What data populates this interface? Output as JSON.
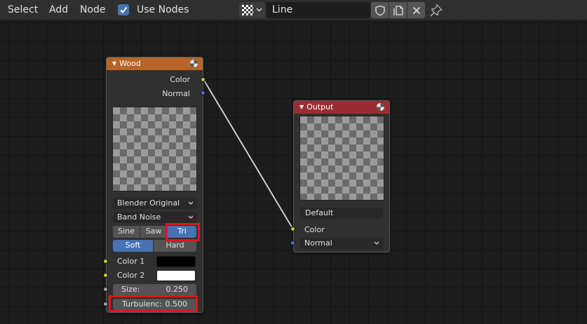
{
  "header": {
    "menu": [
      "Select",
      "Add",
      "Node"
    ],
    "use_nodes": {
      "label": "Use Nodes",
      "checked": true
    },
    "texture_name": "Line"
  },
  "icons": [
    "checker-texture-icon",
    "chevron-down-icon",
    "shield-icon",
    "duplicate-icon",
    "close-icon",
    "pin-icon",
    "texture-node-icon"
  ],
  "colors": {
    "accent": "#4772b3",
    "wood_header": "#b66427",
    "output_header": "#9a2d33",
    "highlight": "#e2141c"
  },
  "wood_node": {
    "title": "Wood",
    "outputs": [
      "Color",
      "Normal"
    ],
    "wood_type": "Blender Original",
    "noise_type": "Band Noise",
    "wave_buttons": [
      "Sine",
      "Saw",
      "Tri"
    ],
    "wave_selected": "Tri",
    "noise_buttons": [
      "Soft",
      "Hard"
    ],
    "noise_selected": "Soft",
    "color1": {
      "label": "Color 1",
      "value": "#000000"
    },
    "color2": {
      "label": "Color 2",
      "value": "#ffffff"
    },
    "size": {
      "label": "Size:",
      "value": "0.250"
    },
    "turbulence": {
      "label": "Turbulenc:",
      "value": "0.500"
    }
  },
  "output_node": {
    "title": "Output",
    "name_field": "Default",
    "color_label": "Color",
    "normal_dropdown": "Normal"
  }
}
